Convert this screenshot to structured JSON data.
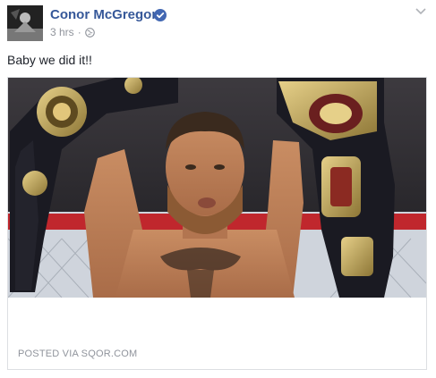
{
  "post": {
    "author": "Conor McGregor",
    "verified": true,
    "timestamp": "3 hrs",
    "separator": "·",
    "audience_icon": "globe-icon",
    "menu_icon": "chevron-down-icon",
    "caption": "Baby we did it!!",
    "attachment": {
      "image": "photo of fighter holding two championship belts overhead",
      "source": "POSTED VIA SQOR.COM"
    }
  },
  "colors": {
    "author_link": "#365899",
    "meta_text": "#90949c",
    "body_text": "#1d2129",
    "verified_badge": "#4267b2",
    "card_border": "#dddfe2"
  }
}
